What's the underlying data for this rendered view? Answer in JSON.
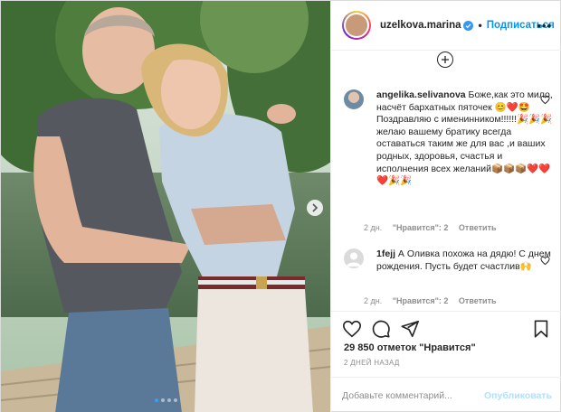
{
  "post": {
    "username": "uzelkova.marina",
    "separator": "•",
    "follow_label": "Подписаться",
    "more_label": "•••"
  },
  "comments": [
    {
      "user": "angelika.selivanova",
      "text": " Боже,как это мило, насчёт бархатных пяточек 😊❤️🤩Поздравляю с именинником!!!!!!🎉🎉🎉 желаю вашему братику всегда оставаться таким же для вас ,и ваших родных, здоровья, счастья и исполнения всех желаний📦📦📦❤️❤️❤️🎉🎉",
      "time": "2 дн.",
      "likes": "\"Нравится\": 2",
      "reply": "Ответить"
    },
    {
      "user": "1fejj",
      "text": " А Оливка похожа на дядю! С днем рождения. Пусть будет счастлив🙌",
      "time": "2 дн.",
      "likes": "\"Нравится\": 2",
      "reply": "Ответить"
    }
  ],
  "stats": {
    "likes": "29 850 отметок \"Нравится\"",
    "date": "2 ДНЕЙ НАЗАД"
  },
  "comment_box": {
    "placeholder": "Добавьте комментарий...",
    "publish_label": "Опубликовать"
  },
  "icons": [
    "heart-icon",
    "comment-icon",
    "share-icon",
    "bookmark-icon",
    "verified-icon",
    "plus-icon",
    "chevron-right-icon"
  ],
  "colors": {
    "accent": "#0095f6",
    "verified": "#3897f0",
    "muted": "#8e8e8e"
  },
  "carousel": {
    "slides": 4,
    "active": 1
  }
}
